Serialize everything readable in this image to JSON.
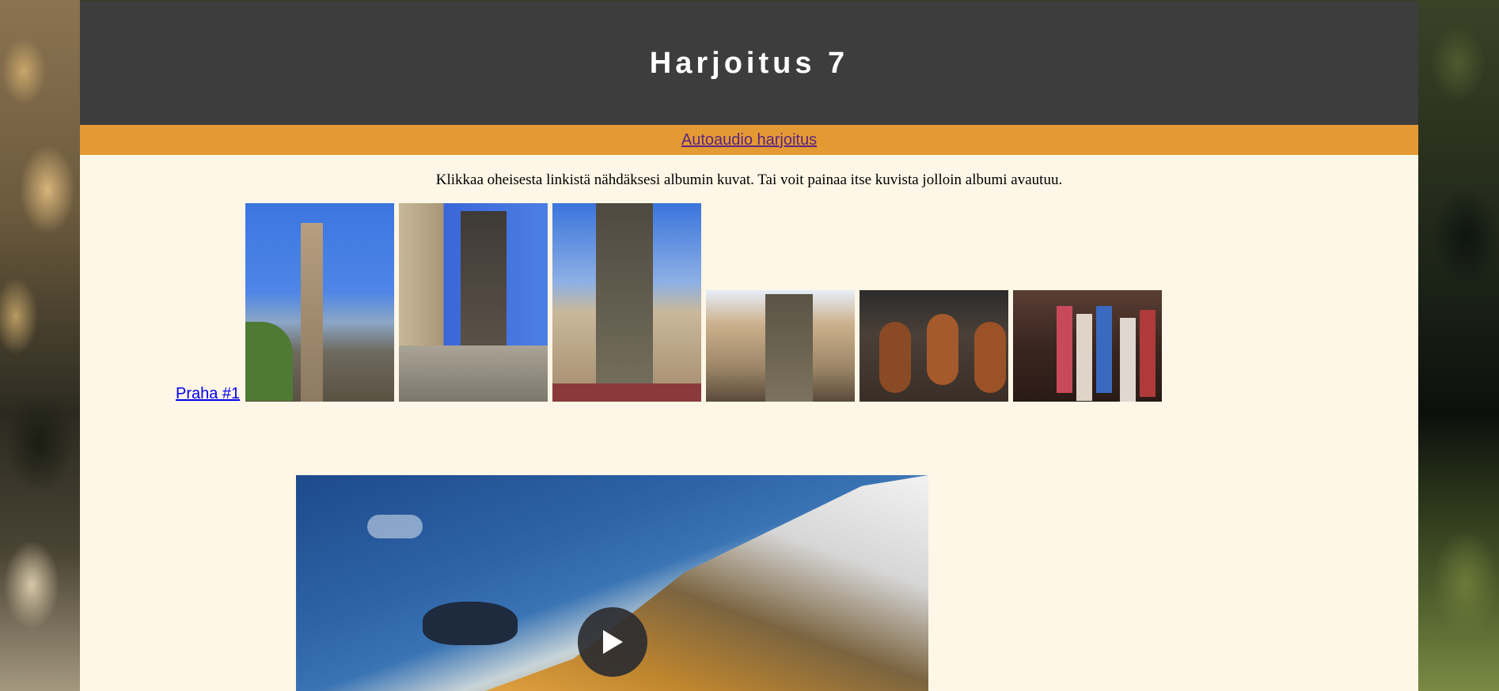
{
  "header": {
    "title": "Harjoitus 7"
  },
  "nav": {
    "link_label": "Autoaudio harjoitus"
  },
  "intro": {
    "text": "Klikkaa oheisesta linkistä nähdäksesi albumin kuvat. Tai voit painaa itse kuvista jolloin albumi avautuu."
  },
  "album": {
    "link_label": "Praha #1",
    "thumbnails": [
      {
        "subject": "charles-bridge-statue"
      },
      {
        "subject": "bridge-tower"
      },
      {
        "subject": "old-town-hall-clock-tower"
      },
      {
        "subject": "astronomical-clock"
      },
      {
        "subject": "roasted-ham"
      },
      {
        "subject": "puppet-shop"
      }
    ]
  },
  "video": {
    "play_icon": "play-icon"
  },
  "colors": {
    "header_bg": "#3d3d3d",
    "nav_bg": "#e49a33",
    "page_bg": "#fef6e6",
    "link_visited": "#5a2680",
    "link": "#0000ee"
  }
}
